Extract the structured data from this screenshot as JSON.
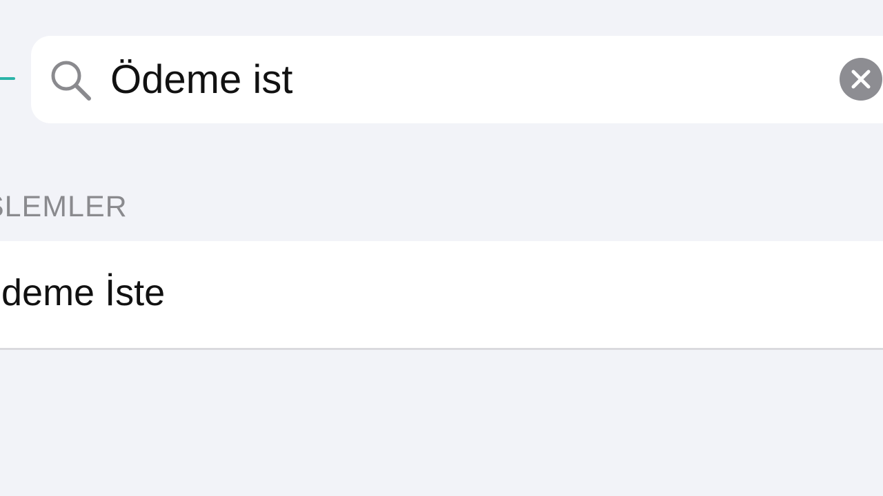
{
  "search": {
    "value": "Ödeme ist",
    "icon": "search-icon",
    "clear_icon": "close-icon"
  },
  "section": {
    "header": "İŞLEMLER"
  },
  "results": [
    {
      "label": "Ödeme İste"
    }
  ],
  "colors": {
    "background": "#f2f3f8",
    "accent": "#2bb3a8",
    "clear_button": "#8d8d92"
  }
}
